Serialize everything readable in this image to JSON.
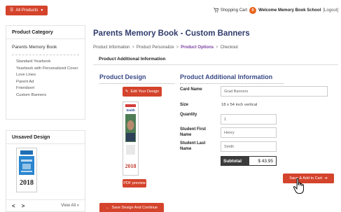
{
  "header": {
    "all_products_label": "All Products",
    "shopping_cart_label": "Shopping Cart",
    "cart_count": "0",
    "welcome_text": "Welcome Memory Book School",
    "logout_label": "[Logout]"
  },
  "sidebar": {
    "title": "Product Category",
    "current_category": "Parents Memory Book",
    "items": [
      {
        "label": "Standard Yearbook"
      },
      {
        "label": "Yearbook with Personalized Cover"
      },
      {
        "label": "Love Lines"
      },
      {
        "label": "Parent Ad"
      },
      {
        "label": "Friendsert"
      },
      {
        "label": "Custom Banners"
      }
    ]
  },
  "unsaved": {
    "title": "Unsaved Design",
    "thumb_year": "2018",
    "view_all_label": "View All »"
  },
  "main": {
    "page_title": "Parents Memory Book - Custom Banners",
    "breadcrumb": [
      {
        "label": "Product Information"
      },
      {
        "label": "Product Personalize"
      },
      {
        "label": "Product Options"
      },
      {
        "label": "Checkout"
      }
    ],
    "breadcrumb_separator": ">",
    "section_heading": "Product Additional Information",
    "design": {
      "title": "Product Design",
      "edit_button_label": "Edit Your Design",
      "preview_name": "Smith",
      "preview_year": "2018",
      "pdf_button_label": "PDF preview",
      "save_continue_label": "Save Design And Continue"
    },
    "info": {
      "title": "Product Additional Information",
      "card_name_label": "Card Name",
      "card_name_value": "Grad Banners",
      "size_label": "Size",
      "size_value": "18 x 54 inch vertical",
      "quantity_label": "Quantity",
      "quantity_value": "1",
      "student_first_name_label": "Student First Name",
      "student_first_name_value": "Henry",
      "student_last_name_label": "Student Last Name",
      "student_last_name_value": "Smith",
      "subtotal_label": "Subtotal",
      "subtotal_value": "$ 43.95",
      "add_to_cart_label": "Save & Add to Cart"
    }
  },
  "colors": {
    "accent_red": "#d4432b",
    "title_navy": "#2f3b6c",
    "breadcrumb_active": "#7b3fa1",
    "cart_badge": "#e8641e"
  },
  "icons": [
    "grid-icon",
    "cart-icon",
    "edit-icon",
    "arrow-left-icon",
    "arrow-right-icon",
    "hand-pointer-icon",
    "chevron-left-icon",
    "chevron-right-icon"
  ]
}
